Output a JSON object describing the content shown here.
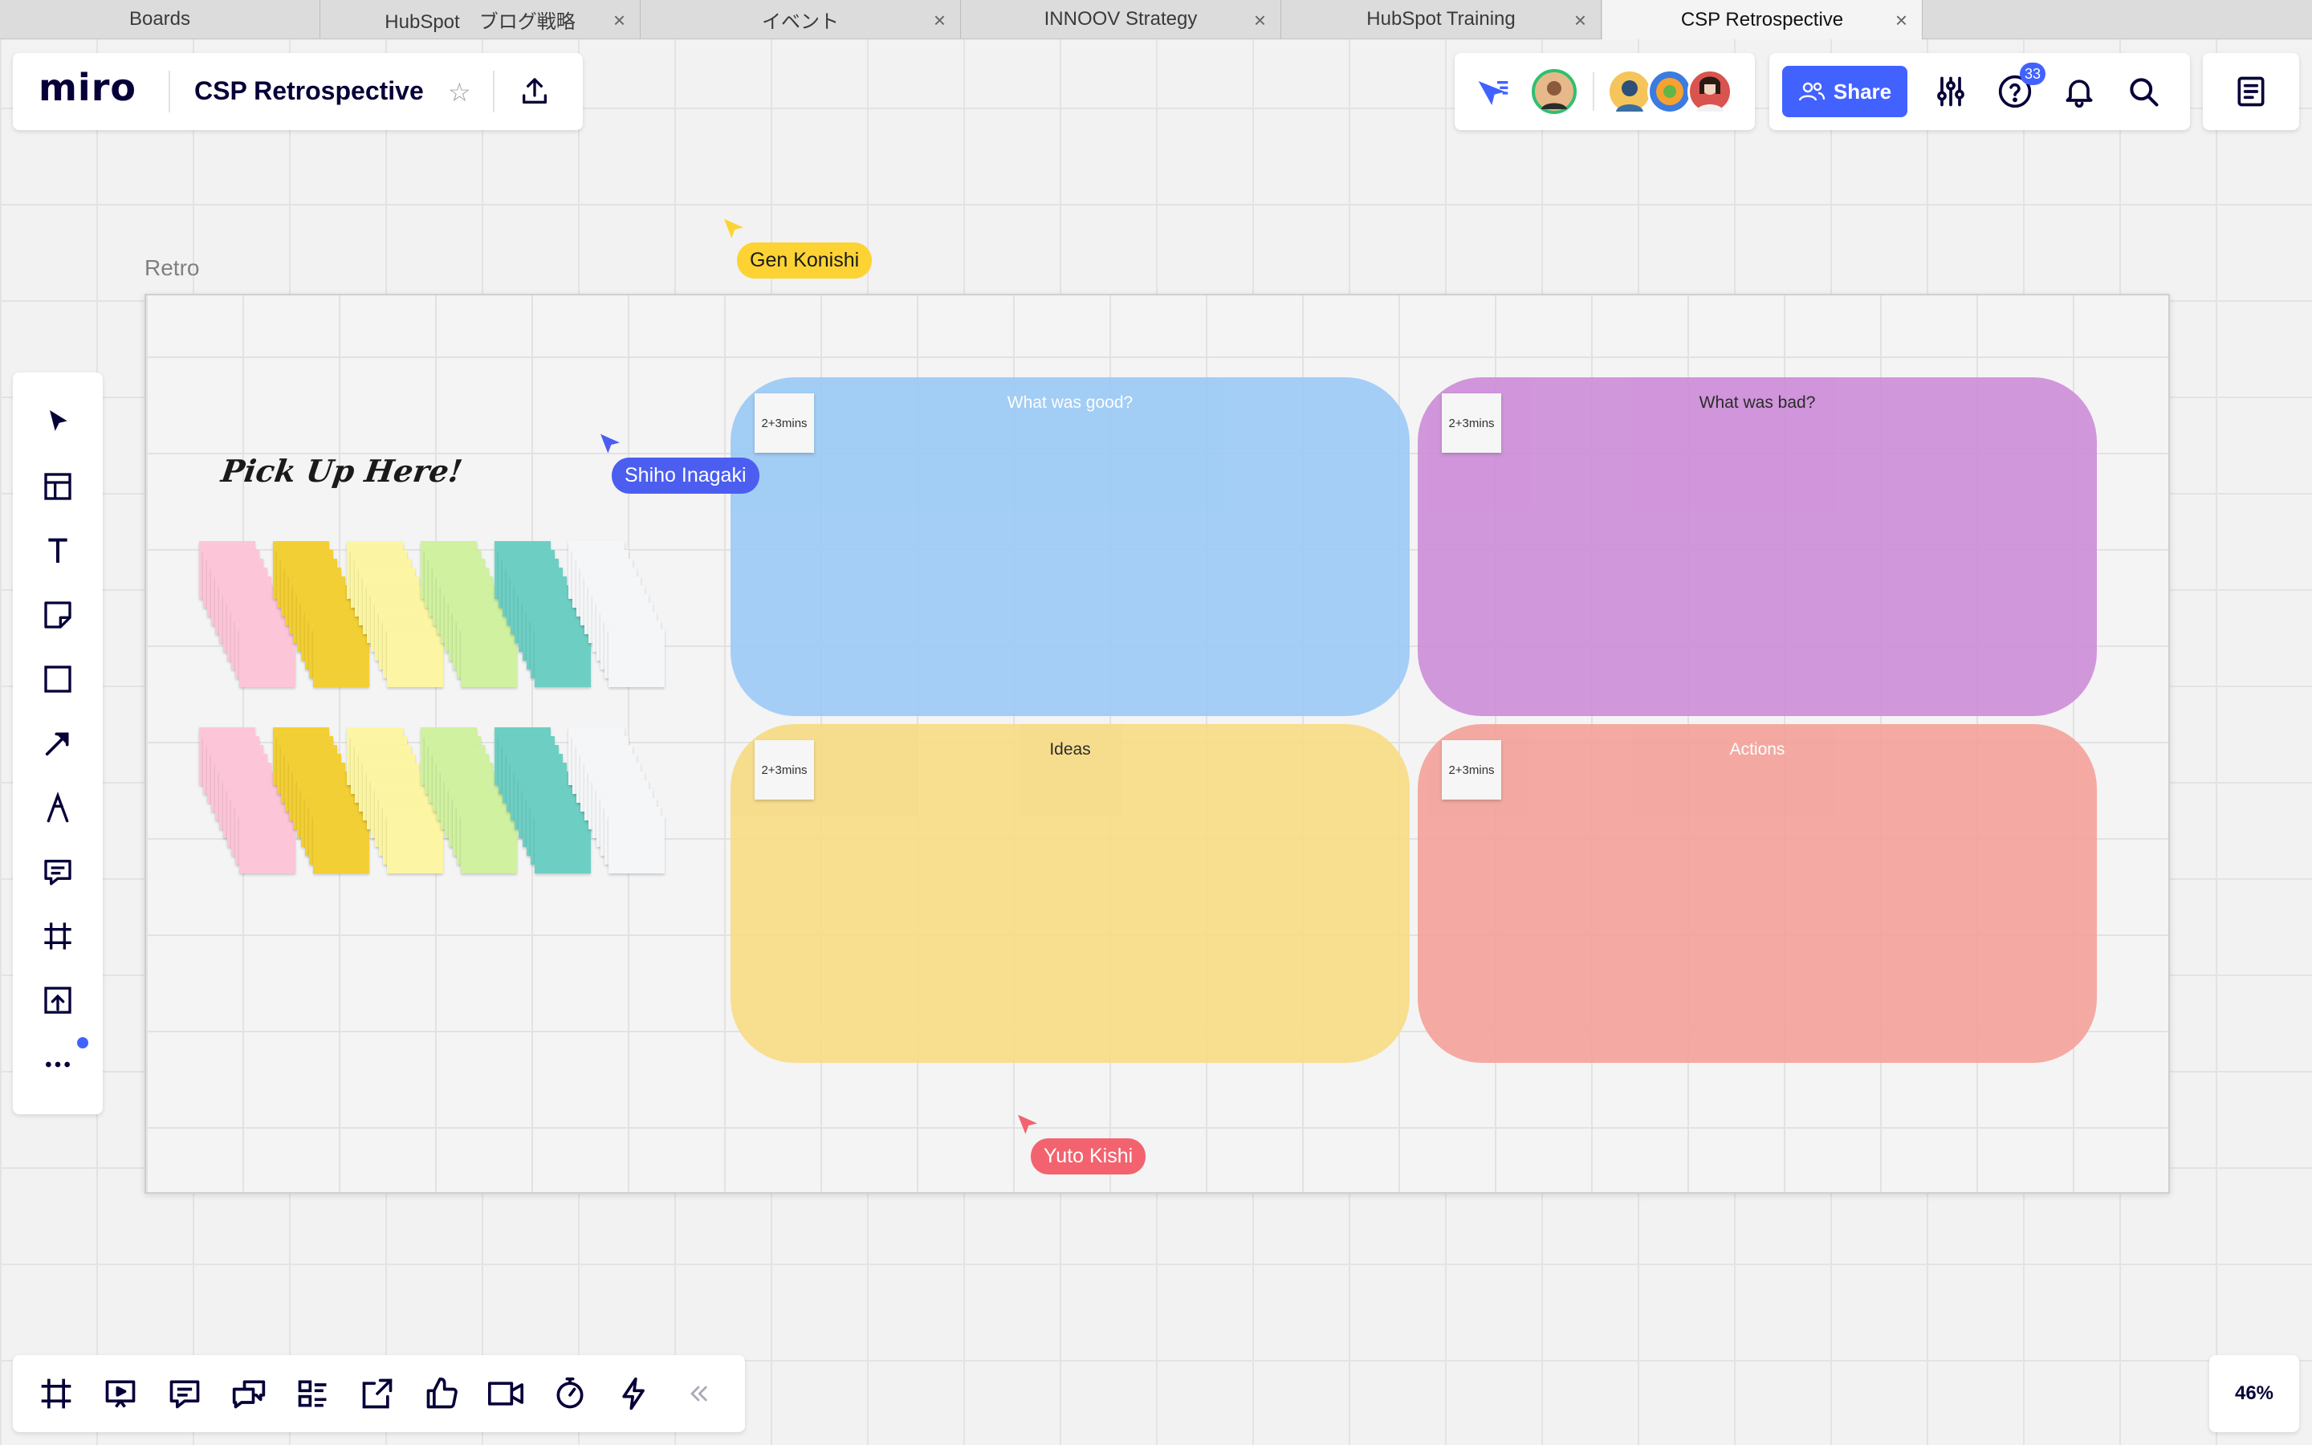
{
  "browser_tabs": [
    {
      "label": "Boards"
    },
    {
      "label": "HubSpot　ブログ戦略"
    },
    {
      "label": "イベント"
    },
    {
      "label": "INNOOV Strategy"
    },
    {
      "label": "HubSpot Training"
    },
    {
      "label": "CSP Retrospective"
    }
  ],
  "app": {
    "logo": "miro",
    "board_name": "CSP Retrospective"
  },
  "header": {
    "share_label": "Share",
    "help_badge": "33"
  },
  "frame": {
    "label": "Retro",
    "pickup_text": "Pick Up Here!"
  },
  "zones": [
    {
      "title": "What was good?",
      "timer": "2+3mins",
      "color": "#9ccaf5",
      "title_color": "#ffffff"
    },
    {
      "title": "What was bad?",
      "timer": "2+3mins",
      "color": "#cd8ed8",
      "title_color": "#1a1a1a"
    },
    {
      "title": "Ideas",
      "timer": "2+3mins",
      "color": "#f6dc85",
      "title_color": "#1a1a1a"
    },
    {
      "title": "Actions",
      "timer": "2+3mins",
      "color": "#f3a39a",
      "title_color": "#ffffff"
    }
  ],
  "sticky_colors": [
    "#fcc6d8",
    "#f2cf34",
    "#fcf6a4",
    "#cff1a0",
    "#6dcfc4",
    "#f5f6f8"
  ],
  "collaborators": [
    {
      "name": "Gen Konishi",
      "color": "#fdd334",
      "text_color": "#1a1a1a"
    },
    {
      "name": "Shiho Inagaki",
      "color": "#4b5ef0",
      "text_color": "#ffffff"
    },
    {
      "name": "Yuto Kishi",
      "color": "#f2636f",
      "text_color": "#ffffff"
    }
  ],
  "toolbar": {
    "tools": [
      "select-icon",
      "templates-icon",
      "text-icon",
      "sticky-note-icon",
      "shape-icon",
      "arrow-icon",
      "pen-icon",
      "comment-icon",
      "frame-icon",
      "upload-icon",
      "more-icon"
    ]
  },
  "bottombar": {
    "buttons": [
      "frames-icon",
      "presentation-icon",
      "comments-icon",
      "chat-icon",
      "card-icon",
      "share-screen-icon",
      "voting-icon",
      "video-icon",
      "timer-icon",
      "lightning-icon",
      "collapse-icon"
    ]
  },
  "zoom": "46%"
}
